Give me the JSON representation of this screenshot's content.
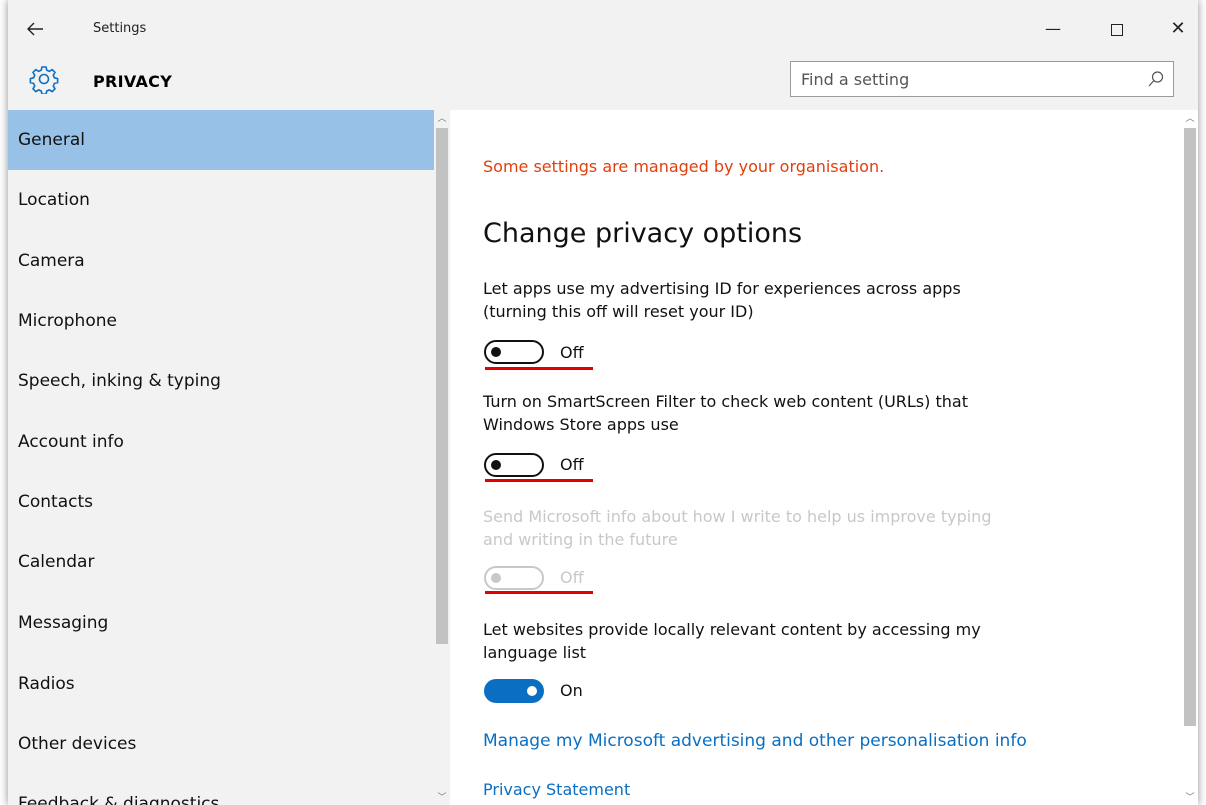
{
  "titlebar": {
    "back_icon": "arrow-left-icon",
    "title": "Settings",
    "minimize_glyph": "—",
    "close_glyph": "✕"
  },
  "header": {
    "section_title": "PRIVACY",
    "search_placeholder": "Find a setting",
    "accent": "#0a6fc2"
  },
  "sidebar": {
    "items": [
      {
        "label": "General",
        "active": true
      },
      {
        "label": "Location"
      },
      {
        "label": "Camera"
      },
      {
        "label": "Microphone"
      },
      {
        "label": "Speech, inking & typing"
      },
      {
        "label": "Account info"
      },
      {
        "label": "Contacts"
      },
      {
        "label": "Calendar"
      },
      {
        "label": "Messaging"
      },
      {
        "label": "Radios"
      },
      {
        "label": "Other devices"
      },
      {
        "label": "Feedback & diagnostics"
      }
    ]
  },
  "main": {
    "managed_notice": "Some settings are managed by your organisation.",
    "heading": "Change privacy options",
    "options": [
      {
        "label_line1": "Let apps use my advertising ID for experiences across apps",
        "label_line2": "(turning this off will reset your ID)",
        "state": "Off",
        "enabled": true
      },
      {
        "label_line1": "Turn on SmartScreen Filter to check web content (URLs) that",
        "label_line2": "Windows Store apps use",
        "state": "Off",
        "enabled": true
      },
      {
        "label_line1": "Send Microsoft info about how I write to help us improve typing",
        "label_line2": "and writing in the future",
        "state": "Off",
        "enabled": false
      },
      {
        "label_line1": "Let websites provide locally relevant content by accessing my",
        "label_line2": "language list",
        "state": "On",
        "enabled": true
      }
    ],
    "links": {
      "manage": "Manage my Microsoft advertising and other personalisation info",
      "privacy": "Privacy Statement"
    }
  }
}
